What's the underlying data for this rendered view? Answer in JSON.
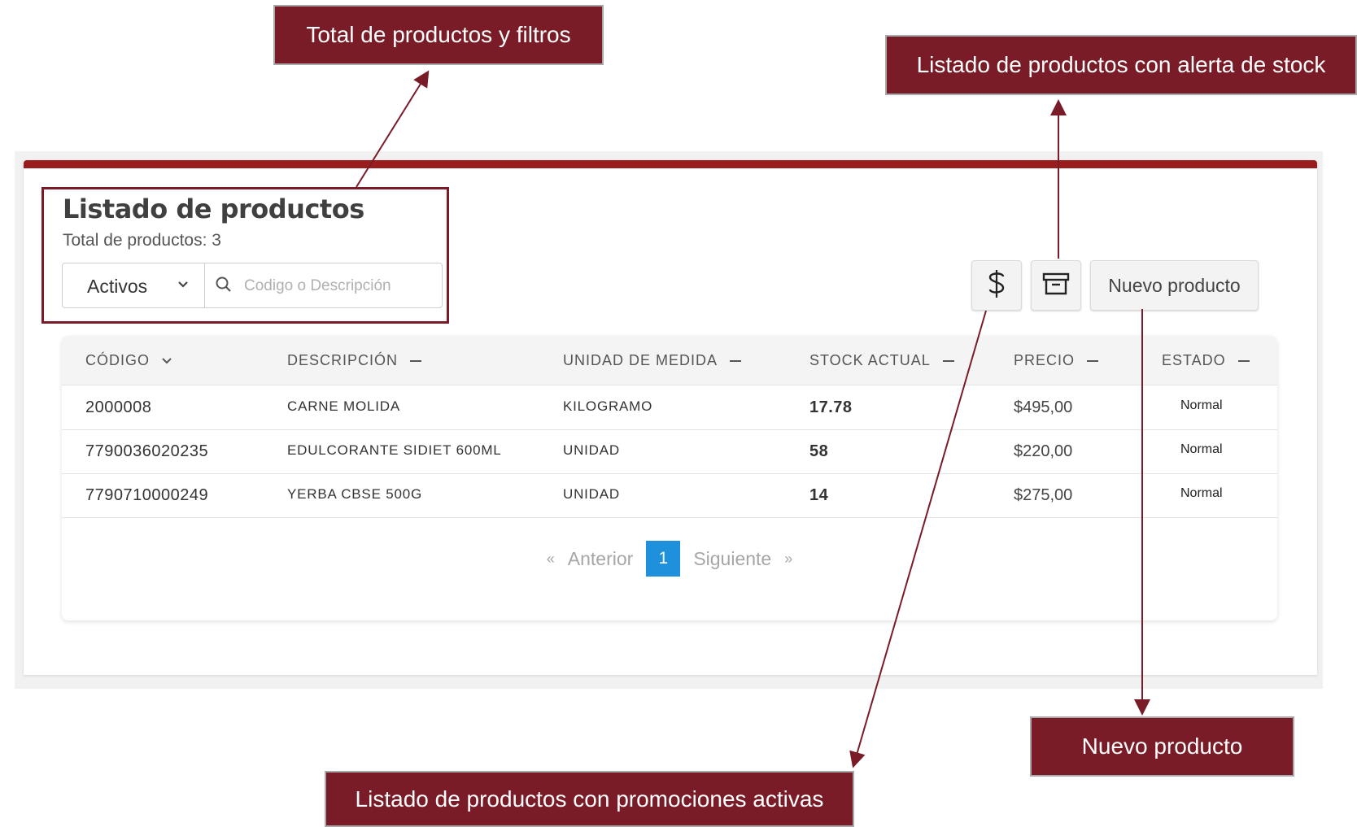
{
  "header": {
    "title": "Listado de productos",
    "total": "Total de productos: 3"
  },
  "filter": {
    "selected": "Activos",
    "search_placeholder": "Codigo o Descripción"
  },
  "toolbar": {
    "new_product_label": "Nuevo producto",
    "promo_icon": "dollar-icon",
    "stock_alert_icon": "archive-icon"
  },
  "table": {
    "columns": [
      "CÓDIGO",
      "DESCRIPCIÓN",
      "UNIDAD DE MEDIDA",
      "STOCK ACTUAL",
      "PRECIO",
      "ESTADO"
    ],
    "rows": [
      {
        "code": "2000008",
        "description": "CARNE MOLIDA",
        "unit": "KILOGRAMO",
        "stock": "17.78",
        "price": "$495,00",
        "state": "Normal"
      },
      {
        "code": "7790036020235",
        "description": "EDULCORANTE SIDIET 600ML",
        "unit": "UNIDAD",
        "stock": "58",
        "price": "$220,00",
        "state": "Normal"
      },
      {
        "code": "7790710000249",
        "description": "YERBA CBSE 500G",
        "unit": "UNIDAD",
        "stock": "14",
        "price": "$275,00",
        "state": "Normal"
      }
    ]
  },
  "pagination": {
    "prev_symbol": "«",
    "prev": "Anterior",
    "current": "1",
    "next": "Siguiente",
    "next_symbol": "»"
  },
  "annotations": {
    "filters": "Total de productos y filtros",
    "stock_alert": "Listado de productos con alerta de stock",
    "new_product": "Nuevo producto",
    "promotions": "Listado de productos con promociones activas"
  },
  "colors": {
    "brand": "#9b1c1f",
    "annotation": "#7a1c27",
    "page_active": "#1e90dc"
  }
}
